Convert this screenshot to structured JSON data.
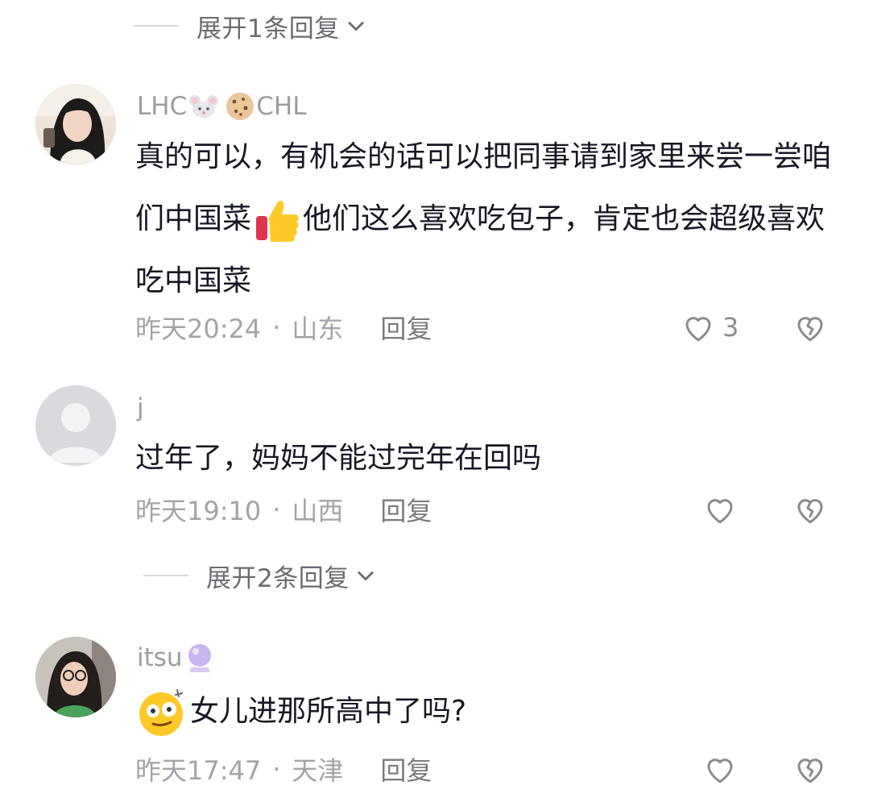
{
  "expand_top": {
    "label": "展开1条回复"
  },
  "comments": [
    {
      "user": "LHC",
      "user_suffix": "CHL",
      "text_a": "真的可以，有机会的话可以把同事请到家里来尝一尝咱们中国菜",
      "text_b": "他们这么喜欢吃包子，肯定也会超级喜欢吃中国菜",
      "time": "昨天20:24",
      "location": "山东",
      "reply": "回复",
      "likes": "3"
    },
    {
      "user": "j",
      "text_a": "过年了，妈妈不能过完年在回吗",
      "time": "昨天19:10",
      "location": "山西",
      "reply": "回复"
    },
    {
      "user": "itsu",
      "text_a": "女儿进那所高中了吗?",
      "time": "昨天17:47",
      "location": "天津",
      "reply": "回复"
    }
  ],
  "expand_mid": {
    "label": "展开2条回复"
  },
  "separator": "·",
  "colors": {
    "text": "#161823",
    "meta": "#a3a3aa",
    "line": "#d8d8dc"
  }
}
